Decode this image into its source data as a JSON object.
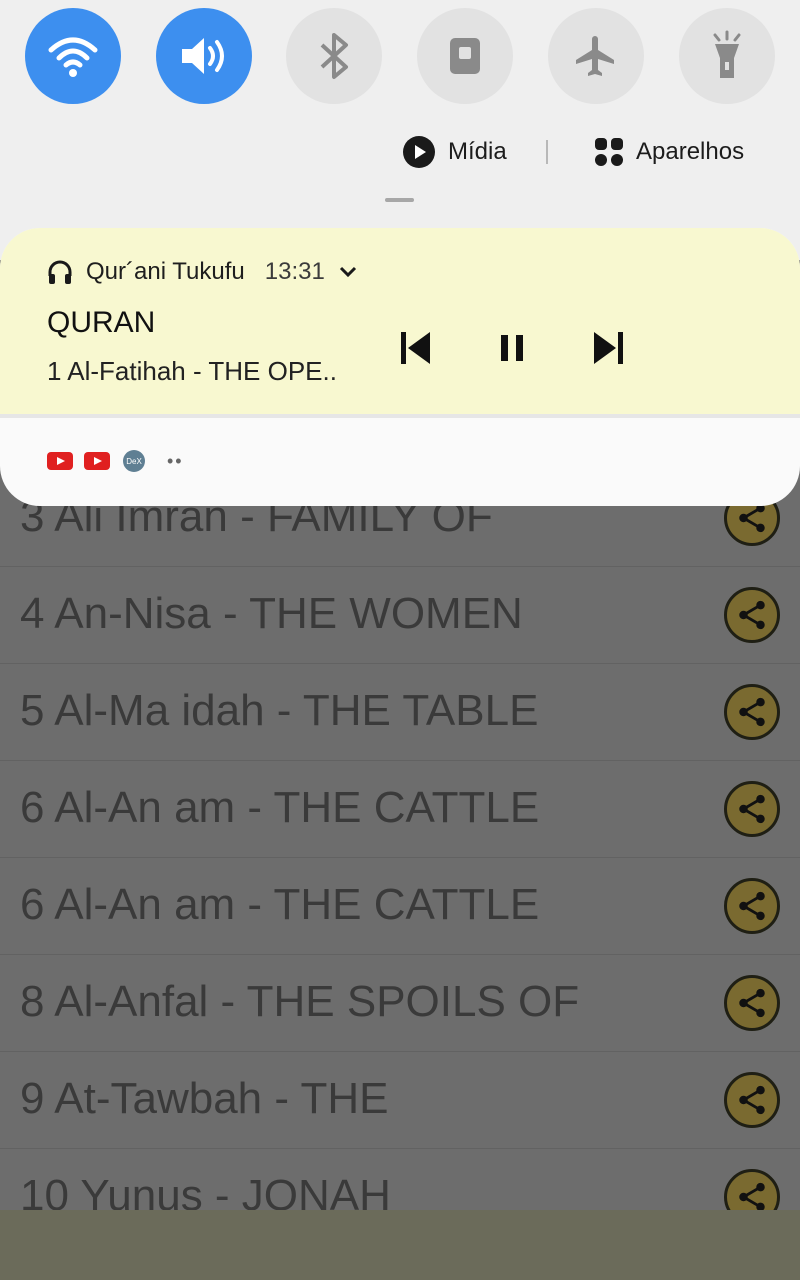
{
  "quick_settings": {
    "media_label": "Mídia",
    "devices_label": "Aparelhos"
  },
  "notification": {
    "app_name": "Qur´ani Tukufu",
    "time": "13:31",
    "title": "QURAN",
    "subtitle": "1 Al-Fatihah - THE OPE..",
    "mini_icons": [
      "youtube-icon",
      "youtube-icon",
      "dex-icon"
    ],
    "dex_text": "DeX"
  },
  "list": {
    "items": [
      "3 Ali  Imran - FAMILY OF",
      "4 An-Nisa - THE WOMEN",
      "5 Al-Ma idah - THE TABLE",
      "6 Al-An am - THE CATTLE",
      "6 Al-An am - THE CATTLE",
      "8 Al-Anfal - THE SPOILS OF",
      "9 At-Tawbah - THE",
      "10 Yunus - JONAH"
    ]
  },
  "colors": {
    "tile_active": "#3d8fef",
    "notification_bg": "#f8f8d0",
    "share_button": "#7a6a30"
  }
}
